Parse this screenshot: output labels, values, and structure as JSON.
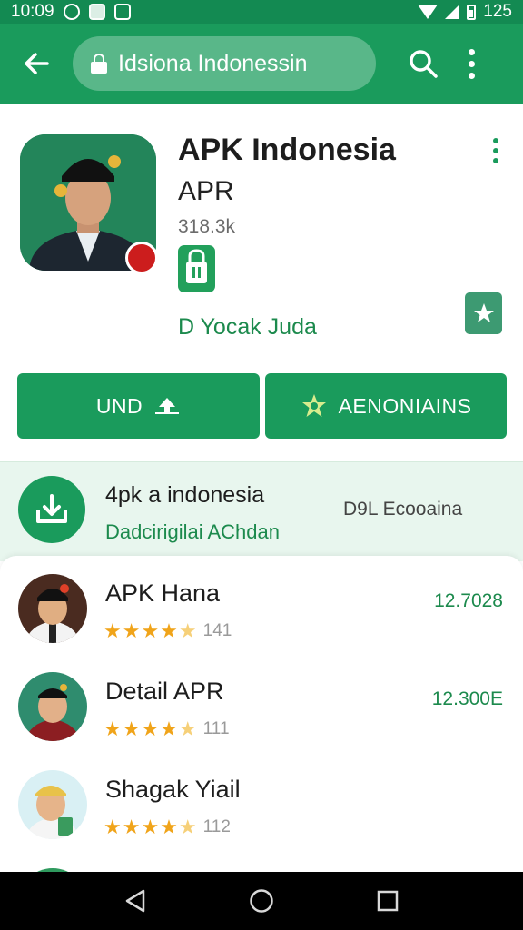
{
  "status_bar": {
    "time": "10:09",
    "battery": "125"
  },
  "app_bar": {
    "url": "Idsiona Indonessin"
  },
  "app": {
    "title": "APK Indonesia",
    "subtitle": "APR",
    "downloads": "318.3k",
    "developer": "D Yocak Juda",
    "install_label": "UND",
    "recs_label": "AENONIAINS"
  },
  "info_strip": {
    "title": "4pk a indonesia",
    "subtitle": "Dadcirigilai AChdan",
    "right_text": "D9L Ecooaina"
  },
  "list": [
    {
      "title": "APK Hana",
      "rating_count": "141",
      "price": "12.7028"
    },
    {
      "title": "Detail APR",
      "rating_count": "111",
      "price": "12.300E"
    },
    {
      "title": "Shagak Yiail",
      "rating_count": "112",
      "price": ""
    }
  ],
  "colors": {
    "primary": "#1a9b5c",
    "status_bar": "#138a52",
    "accent_text": "#1c8a4d",
    "star": "#f0a41a",
    "strip_bg": "#e8f6ee"
  },
  "icons": [
    "back-arrow-icon",
    "lock-icon",
    "search-icon",
    "more-vert-icon",
    "shopping-bag-icon",
    "wishlist-star-icon",
    "download-icon",
    "star-badge-icon",
    "nav-back-icon",
    "nav-home-icon",
    "nav-recents-icon"
  ]
}
